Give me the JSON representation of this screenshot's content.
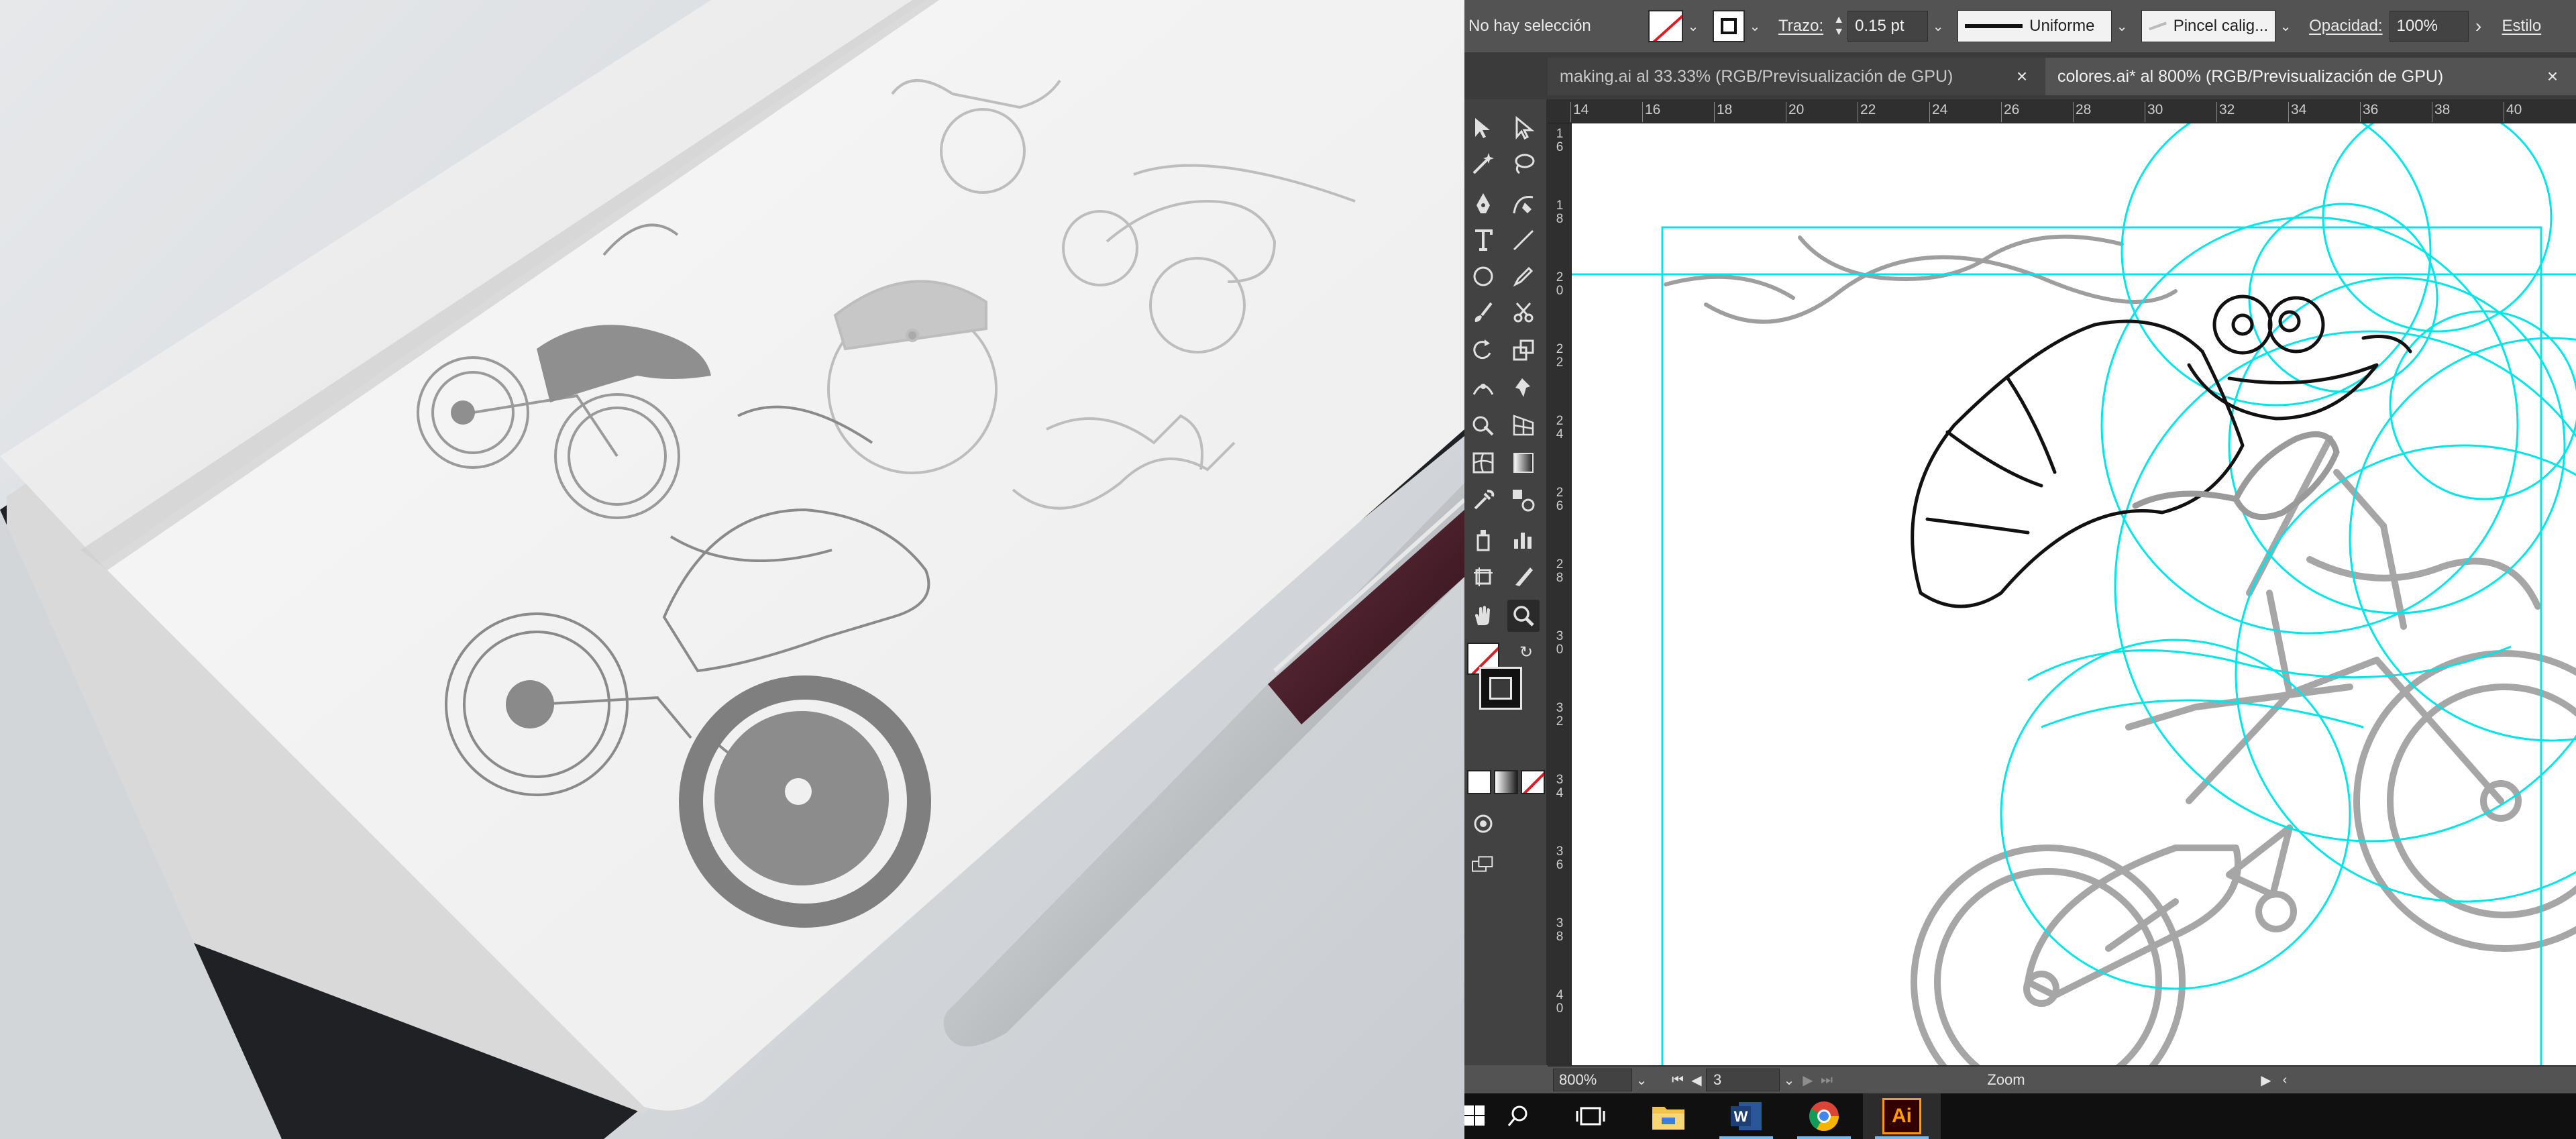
{
  "control_bar": {
    "selection_status": "No hay selección",
    "stroke_label": "Trazo:",
    "stroke_weight": "0.15 pt",
    "stroke_profile": "Uniforme",
    "brush": "Pincel calig...",
    "opacity_label": "Opacidad:",
    "opacity_value": "100%",
    "style_label": "Estilo"
  },
  "tabs": [
    {
      "title": "making.ai al 33.33% (RGB/Previsualización de GPU)",
      "close": "×"
    },
    {
      "title": "colores.ai* al 800% (RGB/Previsualización de GPU)",
      "close": "×"
    }
  ],
  "rulers": {
    "horizontal": [
      "14",
      "16",
      "18",
      "20",
      "22",
      "24",
      "26",
      "28",
      "30",
      "32",
      "34",
      "36",
      "38",
      "40"
    ],
    "vertical": [
      "16",
      "18",
      "20",
      "22",
      "24",
      "26",
      "28",
      "30",
      "32",
      "34",
      "36",
      "38",
      "40"
    ]
  },
  "status_bar": {
    "zoom": "800%",
    "artboard": "3",
    "mode": "Zoom"
  },
  "colors": {
    "ui_bg": "#535353",
    "panel_bg": "#424242",
    "guide": "#00e5e8",
    "artwork_gray": "#a6a6a6",
    "taskbar": "#101010",
    "illustrator_orange": "#ff9a00"
  },
  "icons": {
    "tools": [
      "selection-tool-icon",
      "direct-selection-tool-icon",
      "magic-wand-icon",
      "lasso-icon",
      "pen-tool-icon",
      "curvature-tool-icon",
      "type-tool-icon",
      "line-segment-icon",
      "ellipse-tool-icon",
      "paintbrush-icon",
      "pencil-tool-icon",
      "eraser-icon",
      "rotate-tool-icon",
      "scale-tool-icon",
      "width-tool-icon",
      "puppet-warp-icon",
      "shape-builder-icon",
      "perspective-grid-icon",
      "mesh-tool-icon",
      "gradient-tool-icon",
      "eyedropper-icon",
      "blend-tool-icon",
      "symbol-sprayer-icon",
      "column-graph-icon",
      "artboard-tool-icon",
      "slice-tool-icon",
      "hand-tool-icon",
      "zoom-tool-icon"
    ],
    "taskbar": [
      "windows-start-icon",
      "search-icon",
      "task-view-icon",
      "file-explorer-icon",
      "word-icon",
      "chrome-icon",
      "illustrator-icon"
    ]
  },
  "taskbar_app_label": "Ai"
}
